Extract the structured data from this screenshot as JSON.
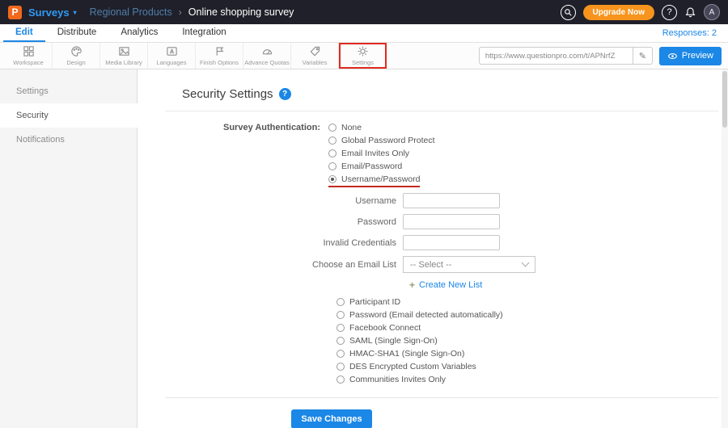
{
  "colors": {
    "accent_blue": "#1B87E6",
    "orange": "#F7941E",
    "highlight_red": "#E02B20",
    "topbar_bg": "#20202A"
  },
  "topbar": {
    "logo_letter": "P",
    "product_label": "Surveys",
    "product_caret": "▾",
    "breadcrumb": {
      "parent": "Regional Products",
      "separator": "›",
      "current": "Online shopping survey"
    },
    "upgrade_label": "Upgrade Now",
    "help_glyph": "?",
    "avatar_letter": "A"
  },
  "nav": {
    "tabs": [
      {
        "label": "Edit",
        "active": true
      },
      {
        "label": "Distribute",
        "active": false
      },
      {
        "label": "Analytics",
        "active": false
      },
      {
        "label": "Integration",
        "active": false
      }
    ],
    "responses_label": "Responses: 2"
  },
  "toolbar": {
    "items": [
      {
        "label": "Workspace"
      },
      {
        "label": "Design"
      },
      {
        "label": "Media Library"
      },
      {
        "label": "Languages"
      },
      {
        "label": "Finish Options"
      },
      {
        "label": "Advance Quotas"
      },
      {
        "label": "Variables"
      },
      {
        "label": "Settings",
        "highlighted": true
      }
    ],
    "url_value": "https://www.questionpro.com/t/APNrfZ",
    "pencil_glyph": "✎",
    "preview_label": "Preview"
  },
  "sidebar": {
    "items": [
      {
        "label": "Settings",
        "active": false
      },
      {
        "label": "Security",
        "active": true
      },
      {
        "label": "Notifications",
        "active": false
      }
    ]
  },
  "main": {
    "title": "Security Settings",
    "help_glyph": "?",
    "auth_label": "Survey Authentication:",
    "auth_options": [
      {
        "label": "None",
        "selected": false
      },
      {
        "label": "Global Password Protect",
        "selected": false
      },
      {
        "label": "Email Invites Only",
        "selected": false
      },
      {
        "label": "Email/Password",
        "selected": false
      },
      {
        "label": "Username/Password",
        "selected": true
      }
    ],
    "fields": [
      {
        "label": "Username",
        "value": ""
      },
      {
        "label": "Password",
        "value": ""
      },
      {
        "label": "Invalid Credentials",
        "value": ""
      },
      {
        "label": "Choose an Email List",
        "value": "-- Select --"
      }
    ],
    "create_list": {
      "icon": "+",
      "label": "Create New List"
    },
    "extra_options": [
      {
        "label": "Participant ID",
        "selected": false
      },
      {
        "label": "Password (Email detected automatically)",
        "selected": false
      },
      {
        "label": "Facebook Connect",
        "selected": false
      },
      {
        "label": "SAML (Single Sign-On)",
        "selected": false
      },
      {
        "label": "HMAC-SHA1 (Single Sign-On)",
        "selected": false
      },
      {
        "label": "DES Encrypted Custom Variables",
        "selected": false
      },
      {
        "label": "Communities Invites Only",
        "selected": false
      }
    ],
    "save_label": "Save Changes"
  }
}
